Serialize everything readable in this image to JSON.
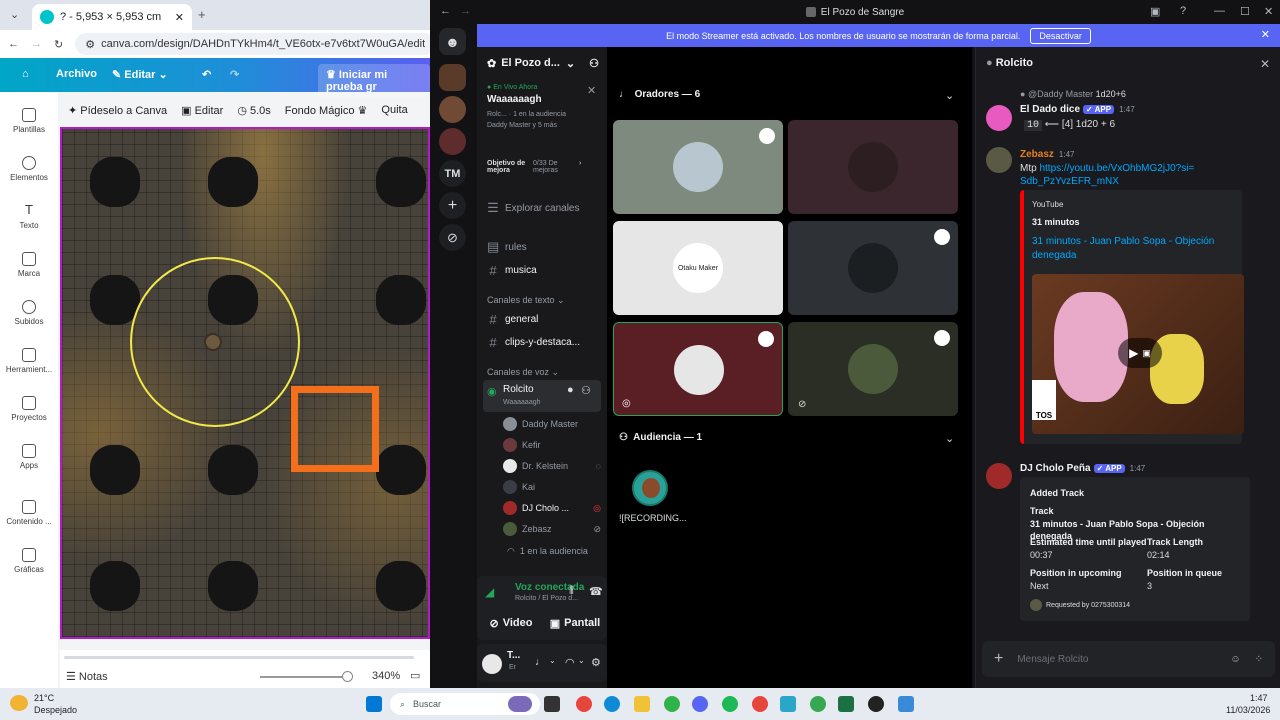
{
  "browser": {
    "tab_title": "? - 5,953 × 5,953 cm",
    "url": "canva.com/design/DAHDnTYkHm4/t_VE6otx-e7v6txt7W0uGA/edit"
  },
  "canva": {
    "menu": {
      "file": "Archivo",
      "edit": "Editar",
      "trial": "Iniciar mi prueba gr"
    },
    "toolbar": {
      "ask": "Pídeselo a Canva",
      "edit": "Editar",
      "duration": "5.0s",
      "magic_bg": "Fondo Mágico",
      "remove": "Quita"
    },
    "sidebar": [
      "Plantillas",
      "Elementos",
      "Texto",
      "Marca",
      "Subidos",
      "Herramient...",
      "Proyectos",
      "Apps",
      "Contenido ...",
      "Gráficas"
    ],
    "notes": "Notas",
    "zoom": "340%"
  },
  "discord": {
    "window_title": "El Pozo de Sangre",
    "streamer_banner": "El modo Streamer está activado. Los nombres de usuario se mostrarán de forma parcial.",
    "streamer_button": "Desactivar",
    "tm_label": "TM",
    "server_name": "El Pozo d...",
    "live": {
      "status": "En Vivo Ahora",
      "title": "Waaaaaagh",
      "line1": "Rolc...",
      "audience": "1 en la audiencia",
      "line2": "Daddy Master y 5 más"
    },
    "goal": {
      "label": "Objetivo de mejora",
      "value": "0/33 De mejoras"
    },
    "explore": "Explorar canales",
    "channels_top": [
      {
        "name": "rules"
      },
      {
        "name": "musica"
      }
    ],
    "text_category": "Canales de texto",
    "text_channels": [
      {
        "name": "general"
      },
      {
        "name": "clips-y-destaca..."
      }
    ],
    "voice_category": "Canales de voz",
    "voice_channel": {
      "name": "Rolcito",
      "topic": "Waaaaaagh"
    },
    "voice_users": [
      {
        "name": "Daddy Master",
        "color": "#8a8f96"
      },
      {
        "name": "Kefir",
        "color": "#6b3a3f"
      },
      {
        "name": "Dr. Kelstein",
        "color": "#e8e8e8"
      },
      {
        "name": "Kai",
        "color": "#3a3d44"
      },
      {
        "name": "DJ Cholo ...",
        "color": "#a02a2a"
      },
      {
        "name": "Zebasz",
        "color": "#4a5a3a"
      }
    ],
    "audience_count_text": "1 en la audiencia",
    "voice_panel": {
      "status": "Voz conectada",
      "detail": "Rolcito / El Pozo d...",
      "video": "Video",
      "screen": "Pantall"
    },
    "user_panel": {
      "name": "T...",
      "status": "Er"
    },
    "stage": {
      "speakers_label": "Oradores — 6",
      "audience_label": "Audiencia — 1",
      "speaker_tiles": [
        {
          "bg": "#7d8a7d",
          "avatar": "#b8c6cf",
          "inner_label": ""
        },
        {
          "bg": "#3a262c",
          "avatar": "#2d1e22",
          "inner_label": ""
        },
        {
          "bg": "#e6e6e6",
          "avatar": "#ffffff",
          "inner_label": "Otaku Maker"
        },
        {
          "bg": "#2e3236",
          "avatar": "#1c1f22",
          "inner_label": ""
        },
        {
          "bg": "#5a1e25",
          "avatar": "#e6e6e6",
          "inner_label": ""
        },
        {
          "bg": "#2b2e24",
          "avatar": "#4b5a3a",
          "inner_label": ""
        }
      ],
      "audience_member": "![RECORDING..."
    },
    "chat": {
      "title": "Rolcito",
      "messages": [
        {
          "reply_to": "@Daddy Master",
          "reply_text": "1d20+6",
          "author": "El Dado dice",
          "app": "APP",
          "time": "1:47",
          "text_total": "10",
          "text_rest": "⟵ [4] 1d20 + 6"
        },
        {
          "author": "Zebasz",
          "time": "1:47",
          "prefix": "Mtp",
          "link": "https://youtu.be/VxOhbMG2jJ0?si=Sdb_PzYvzEFR_mNX",
          "embed": {
            "provider": "YouTube",
            "channel": "31 minutos",
            "title": "31 minutos - Juan Pablo Sopa - Objeción denegada",
            "thumb_text": "TOS"
          }
        },
        {
          "author": "DJ Cholo Peña",
          "app": "APP",
          "time": "1:47",
          "embed": {
            "title": "Added Track",
            "track_label": "Track",
            "track_value": "31 minutos - Juan Pablo Sopa - Objeción denegada",
            "eta_label": "Estimated time until played",
            "eta_value": "00:37",
            "length_label": "Track Length",
            "length_value": "02:14",
            "pos_label": "Position in upcoming",
            "pos_value": "Next",
            "queue_label": "Position in queue",
            "queue_value": "3",
            "footer": "Requested by 0275300314"
          }
        }
      ],
      "input_placeholder": "Mensaje Rolcito"
    }
  },
  "taskbar": {
    "weather_temp": "21°C",
    "weather_desc": "Despejado",
    "search": "Buscar",
    "time": "1:47",
    "date": "11/03/2026"
  }
}
